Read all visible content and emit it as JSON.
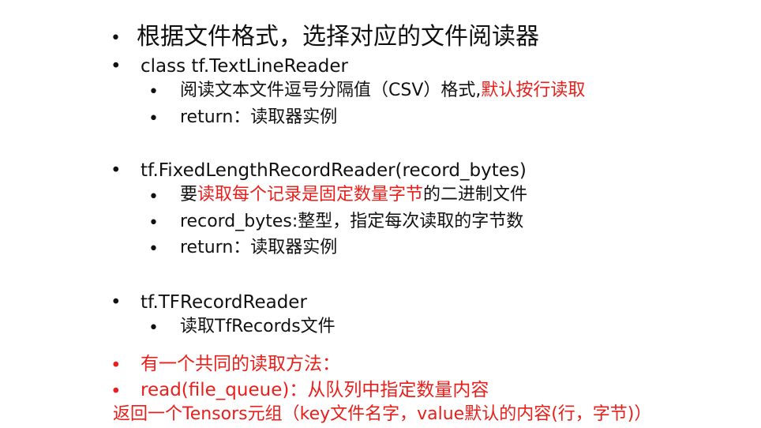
{
  "bullet_glyph": "•",
  "heading": "根据文件格式，选择对应的文件阅读器",
  "textline": {
    "title": "class tf.TextLineReader",
    "desc_prefix": "阅读文本文件逗号分隔值（CSV）格式,",
    "desc_highlight": "默认按行读取",
    "return": "return：读取器实例"
  },
  "fixedlength": {
    "title": "tf.FixedLengthRecordReader(record_bytes)",
    "desc_prefix": "要",
    "desc_highlight": "读取每个记录是固定数量字节",
    "desc_suffix": "的二进制文件",
    "param": "record_bytes:整型，指定每次读取的字节数",
    "return": "return：读取器实例"
  },
  "tfrecord": {
    "title": "tf.TFRecordReader",
    "desc": "读取TfRecords文件"
  },
  "common": {
    "line1": "有一个共同的读取方法：",
    "line2": "read(file_queue)：从队列中指定数量内容",
    "line3": "返回一个Tensors元组（key文件名字，value默认的内容(行，字节)）"
  },
  "colors": {
    "text": "#111111",
    "highlight": "#e8201c",
    "background": "#ffffff"
  }
}
